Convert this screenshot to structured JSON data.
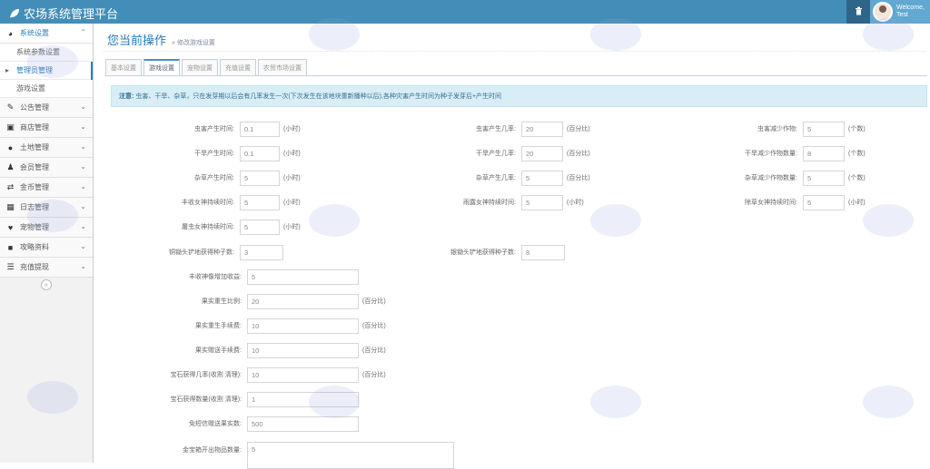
{
  "app": {
    "title": "农场系统管理平台"
  },
  "user": {
    "welcome": "Welcome,",
    "name": "Test"
  },
  "sidebar": {
    "items": [
      {
        "label": "系统设置",
        "icon": "tachometer-icon"
      },
      {
        "label": "系统参数设置"
      },
      {
        "label": "管理员管理"
      },
      {
        "label": "游戏设置"
      },
      {
        "label": "公告管理",
        "icon": "pencil-icon"
      },
      {
        "label": "商店管理",
        "icon": "gift-icon"
      },
      {
        "label": "土地管理",
        "icon": "globe-icon"
      },
      {
        "label": "会员管理",
        "icon": "users-icon"
      },
      {
        "label": "金币管理",
        "icon": "exchange-icon"
      },
      {
        "label": "日志管理",
        "icon": "calendar-icon"
      },
      {
        "label": "宠物管理",
        "icon": "heart-icon"
      },
      {
        "label": "攻略资料",
        "icon": "folder-icon"
      },
      {
        "label": "充值提现",
        "icon": "list-icon"
      }
    ]
  },
  "header": {
    "title": "您当前操作",
    "sub": "» 修改游戏设置"
  },
  "tabs": [
    "基本设置",
    "游戏设置",
    "宠物设置",
    "充值设置",
    "农贸市场设置"
  ],
  "notice": {
    "prefix": "注意:",
    "text": "虫害、干旱、杂草，只在发芽期以后会有几率发生一次(下次发生在该地块重新播种以后),各种灾害产生时间为种子发芽后+产生时间"
  },
  "form": {
    "col1": [
      {
        "label": "虫害产生时间:",
        "value": "0.1",
        "unit": "(小时)"
      },
      {
        "label": "干旱产生时间:",
        "value": "0.1",
        "unit": "(小时)"
      },
      {
        "label": "杂草产生时间:",
        "value": "5",
        "unit": "(小时)"
      },
      {
        "label": "丰收女神持续时间:",
        "value": "5",
        "unit": "(小时)"
      },
      {
        "label": "屠虫女神持续时间:",
        "value": "5",
        "unit": "(小时)"
      }
    ],
    "col2": [
      {
        "label": "虫害产生几率:",
        "value": "20",
        "unit": "(百分比)"
      },
      {
        "label": "干旱产生几率:",
        "value": "20",
        "unit": "(百分比)"
      },
      {
        "label": "杂草产生几率:",
        "value": "5",
        "unit": "(百分比)"
      },
      {
        "label": "雨露女神持续时间:",
        "value": "5",
        "unit": "(小时)"
      }
    ],
    "col3": [
      {
        "label": "虫害减少作物:",
        "value": "5",
        "unit": "(个数)"
      },
      {
        "label": "干旱减少作物数量:",
        "value": "8",
        "unit": "(个数)"
      },
      {
        "label": "杂草减少作物数量:",
        "value": "5",
        "unit": "(个数)"
      },
      {
        "label": "除草女神持续时间:",
        "value": "5",
        "unit": "(小时)"
      }
    ],
    "row_hoe": [
      {
        "label": "铜锄头铲地获得种子数:",
        "value": "3"
      },
      {
        "label": "银锄头铲地获得种子数:",
        "value": "8"
      }
    ],
    "wide": [
      {
        "label": "丰收神像增加收益:",
        "value": "5",
        "unit": ""
      },
      {
        "label": "果实重生比例:",
        "value": "20",
        "unit": "(百分比)"
      },
      {
        "label": "果实重生手续费:",
        "value": "10",
        "unit": "(百分比)"
      },
      {
        "label": "果实赠送手续费:",
        "value": "10",
        "unit": "(百分比)"
      },
      {
        "label": "宝石获得几率(收割 清理):",
        "value": "10",
        "unit": "(百分比)"
      },
      {
        "label": "宝石获得数量(收割 清理):",
        "value": "1",
        "unit": ""
      },
      {
        "label": "免短信赠送果实数:",
        "value": "500",
        "unit": ""
      }
    ],
    "box": {
      "label": "金宝箱开出物品数量:",
      "value": "5"
    }
  },
  "colors": {
    "topbar": "#438eb9",
    "accent": "#2679b5",
    "notice_bg": "#d9edf7"
  }
}
